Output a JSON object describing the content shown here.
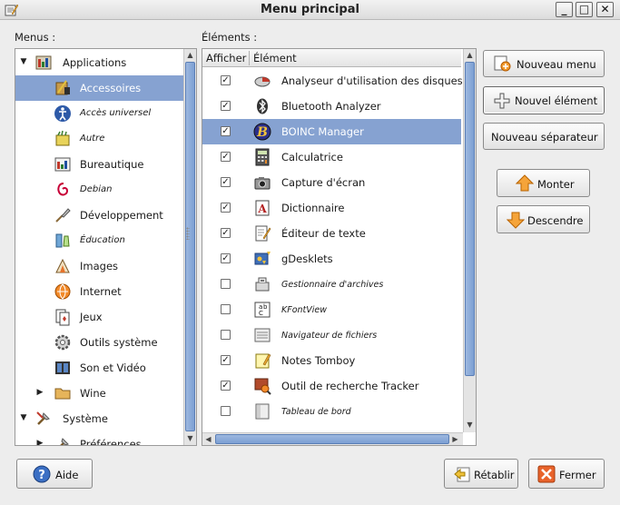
{
  "window": {
    "title": "Menu principal"
  },
  "menus_label": "Menus :",
  "items_label": "Éléments :",
  "columns": {
    "show": "Afficher",
    "item": "Élément"
  },
  "tree": [
    {
      "label": "Applications",
      "expander": "▼",
      "icon": "applications-icon",
      "italic": false,
      "selected": false,
      "level": 0
    },
    {
      "label": "Accessoires",
      "expander": "",
      "icon": "accessories-icon",
      "italic": false,
      "selected": true,
      "level": 1
    },
    {
      "label": "Accès universel",
      "expander": "",
      "icon": "universal-access-icon",
      "italic": true,
      "selected": false,
      "level": 1
    },
    {
      "label": "Autre",
      "expander": "",
      "icon": "other-icon",
      "italic": true,
      "selected": false,
      "level": 1
    },
    {
      "label": "Bureautique",
      "expander": "",
      "icon": "office-icon",
      "italic": false,
      "selected": false,
      "level": 1
    },
    {
      "label": "Debian",
      "expander": "",
      "icon": "debian-icon",
      "italic": true,
      "selected": false,
      "level": 1
    },
    {
      "label": "Développement",
      "expander": "",
      "icon": "development-icon",
      "italic": false,
      "selected": false,
      "level": 1
    },
    {
      "label": "Éducation",
      "expander": "",
      "icon": "education-icon",
      "italic": true,
      "selected": false,
      "level": 1
    },
    {
      "label": "Images",
      "expander": "",
      "icon": "graphics-icon",
      "italic": false,
      "selected": false,
      "level": 1
    },
    {
      "label": "Internet",
      "expander": "",
      "icon": "internet-icon",
      "italic": false,
      "selected": false,
      "level": 1
    },
    {
      "label": "Jeux",
      "expander": "",
      "icon": "games-icon",
      "italic": false,
      "selected": false,
      "level": 1
    },
    {
      "label": "Outils système",
      "expander": "",
      "icon": "system-tools-icon",
      "italic": false,
      "selected": false,
      "level": 1
    },
    {
      "label": "Son et Vidéo",
      "expander": "",
      "icon": "multimedia-icon",
      "italic": false,
      "selected": false,
      "level": 1
    },
    {
      "label": "Wine",
      "expander": "▶",
      "icon": "folder-icon",
      "italic": false,
      "selected": false,
      "level": 1
    },
    {
      "label": "Système",
      "expander": "▼",
      "icon": "system-icon",
      "italic": false,
      "selected": false,
      "level": 0
    },
    {
      "label": "Préférences",
      "expander": "▶",
      "icon": "preferences-icon",
      "italic": false,
      "selected": false,
      "level": 1
    }
  ],
  "items": [
    {
      "label": "Analyseur d'utilisation des disques",
      "checked": true,
      "italic": false,
      "selected": false,
      "icon": "disk-usage-icon"
    },
    {
      "label": "Bluetooth Analyzer",
      "checked": true,
      "italic": false,
      "selected": false,
      "icon": "bluetooth-icon"
    },
    {
      "label": "BOINC Manager",
      "checked": true,
      "italic": false,
      "selected": true,
      "icon": "boinc-icon"
    },
    {
      "label": "Calculatrice",
      "checked": true,
      "italic": false,
      "selected": false,
      "icon": "calculator-icon"
    },
    {
      "label": "Capture d'écran",
      "checked": true,
      "italic": false,
      "selected": false,
      "icon": "screenshot-icon"
    },
    {
      "label": "Dictionnaire",
      "checked": true,
      "italic": false,
      "selected": false,
      "icon": "dictionary-icon"
    },
    {
      "label": "Éditeur de texte",
      "checked": true,
      "italic": false,
      "selected": false,
      "icon": "text-editor-icon"
    },
    {
      "label": "gDesklets",
      "checked": true,
      "italic": false,
      "selected": false,
      "icon": "gdesklets-icon"
    },
    {
      "label": "Gestionnaire d'archives",
      "checked": false,
      "italic": true,
      "selected": false,
      "icon": "archive-manager-icon"
    },
    {
      "label": "KFontView",
      "checked": false,
      "italic": true,
      "selected": false,
      "icon": "font-viewer-icon"
    },
    {
      "label": "Navigateur de fichiers",
      "checked": false,
      "italic": true,
      "selected": false,
      "icon": "file-browser-icon"
    },
    {
      "label": "Notes Tomboy",
      "checked": true,
      "italic": false,
      "selected": false,
      "icon": "tomboy-icon"
    },
    {
      "label": "Outil de recherche Tracker",
      "checked": true,
      "italic": false,
      "selected": false,
      "icon": "tracker-search-icon"
    },
    {
      "label": "Tableau de bord",
      "checked": false,
      "italic": true,
      "selected": false,
      "icon": "panel-icon"
    }
  ],
  "buttons": {
    "new_menu": "Nouveau menu",
    "new_item": "Nouvel élément",
    "new_separator": "Nouveau séparateur",
    "move_up": "Monter",
    "move_down": "Descendre",
    "help": "Aide",
    "revert": "Rétablir",
    "close": "Fermer"
  },
  "checkmark": "✓",
  "colors": {
    "selection": "#86a2d1",
    "scroll_thumb": "#7c9fd3"
  }
}
